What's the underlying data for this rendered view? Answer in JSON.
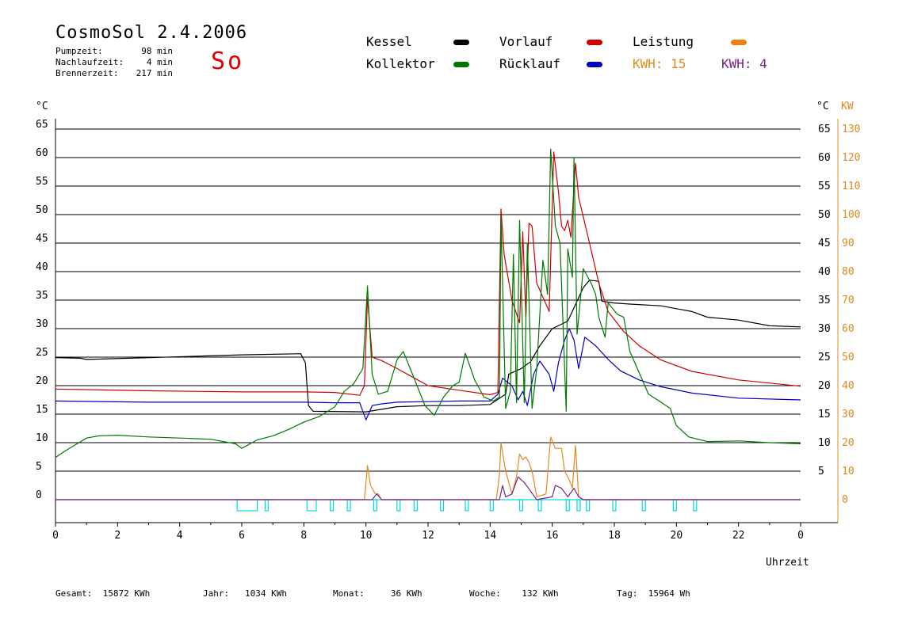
{
  "header": {
    "title": "CosmoSol 2.4.2006",
    "day": "So",
    "stats": [
      {
        "label": "Pumpzeit:",
        "value": "98 min"
      },
      {
        "label": "Nachlaufzeit:",
        "value": "4 min"
      },
      {
        "label": "Brennerzeit:",
        "value": "217 min"
      }
    ]
  },
  "legend": {
    "kessel": {
      "label": "Kessel",
      "color": "#000000"
    },
    "kollektor": {
      "label": "Kollektor",
      "color": "#007800"
    },
    "vorlauf": {
      "label": "Vorlauf",
      "color": "#d00000"
    },
    "ruecklauf": {
      "label": "Rücklauf",
      "color": "#0000c0"
    },
    "leistung": {
      "label": "Leistung",
      "color": "#f08010"
    },
    "kwh_orange": "KWH: 15",
    "kwh_purple": "KWH: 4",
    "kwh_orange_color": "#e08a1e",
    "kwh_purple_color": "#7a1f8a"
  },
  "footer": {
    "gesamt": "Gesamt:  15872 KWh",
    "jahr": "Jahr:   1034 KWh",
    "monat": "Monat:     36 KWh",
    "woche": "Woche:    132 KWh",
    "tag": "Tag:  15964 Wh"
  },
  "chart_data": {
    "type": "line",
    "title": "",
    "xlabel": "Uhrzeit",
    "ylabel_left": "°C",
    "ylabel_right_temp": "°C",
    "ylabel_right_power": "KW",
    "xlim": [
      0,
      24
    ],
    "ylim": [
      0,
      65
    ],
    "y2lim": [
      0,
      130
    ],
    "x_ticks": [
      "0",
      "2",
      "4",
      "6",
      "8",
      "10",
      "12",
      "14",
      "16",
      "18",
      "20",
      "22",
      "0"
    ],
    "y_ticks": [
      "0",
      "5",
      "10",
      "15",
      "20",
      "25",
      "30",
      "35",
      "40",
      "45",
      "50",
      "55",
      "60",
      "65"
    ],
    "y2_ticks": [
      "0",
      "10",
      "20",
      "30",
      "40",
      "50",
      "60",
      "70",
      "80",
      "90",
      "100",
      "110",
      "120",
      "130"
    ],
    "grid": true,
    "series": [
      {
        "name": "Kessel",
        "color": "#000000",
        "points": [
          [
            0,
            24.9
          ],
          [
            0.8,
            24.8
          ],
          [
            1,
            24.6
          ],
          [
            3,
            24.9
          ],
          [
            6,
            25.4
          ],
          [
            7.9,
            25.6
          ],
          [
            8.05,
            24
          ],
          [
            8.1,
            20
          ],
          [
            8.15,
            16.5
          ],
          [
            8.3,
            15.5
          ],
          [
            10,
            15.4
          ],
          [
            11,
            16.3
          ],
          [
            12,
            16.5
          ],
          [
            13,
            16.5
          ],
          [
            14,
            16.7
          ],
          [
            14.5,
            18.5
          ],
          [
            14.6,
            22
          ],
          [
            15,
            23
          ],
          [
            15.3,
            24.2
          ],
          [
            15.6,
            27
          ],
          [
            16,
            30
          ],
          [
            16.5,
            31.3
          ],
          [
            17,
            37.2
          ],
          [
            17.2,
            38.5
          ],
          [
            17.5,
            38.3
          ],
          [
            17.6,
            34.8
          ],
          [
            18,
            34.5
          ],
          [
            18.5,
            34.3
          ],
          [
            19.5,
            34
          ],
          [
            20,
            33.5
          ],
          [
            20.5,
            33
          ],
          [
            21,
            32
          ],
          [
            22,
            31.5
          ],
          [
            23,
            30.5
          ],
          [
            24,
            30.3
          ]
        ]
      },
      {
        "name": "Vorlauf",
        "color": "#d00000",
        "points": [
          [
            0,
            19.4
          ],
          [
            3,
            19.1
          ],
          [
            6,
            18.9
          ],
          [
            8,
            18.9
          ],
          [
            9,
            18.8
          ],
          [
            9.8,
            18.3
          ],
          [
            9.95,
            20
          ],
          [
            10.05,
            35.5
          ],
          [
            10.2,
            25
          ],
          [
            10.5,
            24.4
          ],
          [
            11,
            23
          ],
          [
            11.5,
            21.5
          ],
          [
            12,
            20
          ],
          [
            13,
            19.2
          ],
          [
            14,
            18.4
          ],
          [
            14.25,
            18.8
          ],
          [
            14.35,
            51
          ],
          [
            14.45,
            43
          ],
          [
            14.7,
            35
          ],
          [
            14.95,
            31
          ],
          [
            15.05,
            47
          ],
          [
            15.15,
            32
          ],
          [
            15.25,
            48.5
          ],
          [
            15.35,
            48
          ],
          [
            15.5,
            38
          ],
          [
            15.9,
            33
          ],
          [
            16.05,
            61
          ],
          [
            16.2,
            54
          ],
          [
            16.3,
            48
          ],
          [
            16.4,
            47.2
          ],
          [
            16.5,
            49
          ],
          [
            16.6,
            46
          ],
          [
            16.75,
            59
          ],
          [
            16.85,
            53
          ],
          [
            17.2,
            45
          ],
          [
            17.5,
            38
          ],
          [
            17.8,
            33
          ],
          [
            18.3,
            29.5
          ],
          [
            18.8,
            27
          ],
          [
            19.5,
            24.5
          ],
          [
            20.5,
            22.5
          ],
          [
            22,
            21
          ],
          [
            24,
            19.9
          ]
        ]
      },
      {
        "name": "Rücklauf",
        "color": "#0000c0",
        "points": [
          [
            0,
            17.3
          ],
          [
            3,
            17.1
          ],
          [
            6,
            17.1
          ],
          [
            8,
            17.1
          ],
          [
            9,
            17
          ],
          [
            9.8,
            17
          ],
          [
            10.0,
            14
          ],
          [
            10.2,
            16.5
          ],
          [
            10.5,
            16.8
          ],
          [
            11,
            17.1
          ],
          [
            12,
            17.2
          ],
          [
            13,
            17.3
          ],
          [
            14,
            17.3
          ],
          [
            14.25,
            18.5
          ],
          [
            14.4,
            21.3
          ],
          [
            14.7,
            20
          ],
          [
            14.9,
            17.5
          ],
          [
            15.05,
            19
          ],
          [
            15.2,
            16.5
          ],
          [
            15.4,
            22
          ],
          [
            15.6,
            24.3
          ],
          [
            15.9,
            22
          ],
          [
            16.05,
            19
          ],
          [
            16.2,
            24
          ],
          [
            16.4,
            28
          ],
          [
            16.55,
            30
          ],
          [
            16.7,
            28
          ],
          [
            16.85,
            23
          ],
          [
            17.05,
            28.5
          ],
          [
            17.4,
            27
          ],
          [
            17.8,
            24.6
          ],
          [
            18.2,
            22.6
          ],
          [
            18.8,
            21
          ],
          [
            19.5,
            19.8
          ],
          [
            20.5,
            18.7
          ],
          [
            22,
            17.8
          ],
          [
            24,
            17.5
          ]
        ]
      },
      {
        "name": "Kollektor",
        "color": "#007800",
        "points": [
          [
            0,
            7.4
          ],
          [
            0.3,
            8.5
          ],
          [
            0.6,
            9.5
          ],
          [
            1,
            10.8
          ],
          [
            1.4,
            11.2
          ],
          [
            2,
            11.3
          ],
          [
            3,
            11
          ],
          [
            4,
            10.8
          ],
          [
            5,
            10.6
          ],
          [
            5.8,
            9.8
          ],
          [
            6,
            9
          ],
          [
            6.5,
            10.5
          ],
          [
            7,
            11.2
          ],
          [
            7.5,
            12.3
          ],
          [
            8,
            13.6
          ],
          [
            8.5,
            14.6
          ],
          [
            9,
            16.3
          ],
          [
            9.3,
            19
          ],
          [
            9.6,
            20.3
          ],
          [
            9.9,
            23
          ],
          [
            10.05,
            37.5
          ],
          [
            10.2,
            22
          ],
          [
            10.4,
            18.5
          ],
          [
            10.7,
            19
          ],
          [
            11,
            24.5
          ],
          [
            11.2,
            26
          ],
          [
            11.5,
            22
          ],
          [
            11.9,
            16.5
          ],
          [
            12.2,
            14.8
          ],
          [
            12.5,
            18
          ],
          [
            12.8,
            20
          ],
          [
            13,
            20.6
          ],
          [
            13.2,
            25.7
          ],
          [
            13.5,
            21
          ],
          [
            13.8,
            18
          ],
          [
            14.1,
            17.3
          ],
          [
            14.3,
            18
          ],
          [
            14.35,
            49.5
          ],
          [
            14.5,
            16
          ],
          [
            14.65,
            19
          ],
          [
            14.75,
            43
          ],
          [
            14.85,
            17
          ],
          [
            14.95,
            49
          ],
          [
            15.1,
            17
          ],
          [
            15.2,
            45
          ],
          [
            15.35,
            16
          ],
          [
            15.5,
            23
          ],
          [
            15.7,
            42
          ],
          [
            15.85,
            36
          ],
          [
            15.95,
            61.5
          ],
          [
            16.1,
            48
          ],
          [
            16.25,
            45
          ],
          [
            16.45,
            15.5
          ],
          [
            16.5,
            44
          ],
          [
            16.65,
            39
          ],
          [
            16.7,
            60
          ],
          [
            16.8,
            29
          ],
          [
            17,
            40.5
          ],
          [
            17.25,
            38
          ],
          [
            17.4,
            36
          ],
          [
            17.5,
            32
          ],
          [
            17.7,
            28.5
          ],
          [
            17.8,
            34.5
          ],
          [
            18.1,
            32.5
          ],
          [
            18.3,
            32
          ],
          [
            18.5,
            26
          ],
          [
            18.9,
            21
          ],
          [
            19.1,
            18.5
          ],
          [
            19.5,
            17.1
          ],
          [
            19.8,
            16
          ],
          [
            20,
            13
          ],
          [
            20.4,
            11
          ],
          [
            21,
            10.2
          ],
          [
            22,
            10.3
          ],
          [
            23,
            10
          ],
          [
            24,
            9.8
          ]
        ]
      },
      {
        "name": "Leistung",
        "color": "#e08a1e",
        "axis": "right",
        "points": [
          [
            0,
            0
          ],
          [
            9.95,
            0
          ],
          [
            10.05,
            12
          ],
          [
            10.15,
            5
          ],
          [
            10.3,
            2
          ],
          [
            10.4,
            2
          ],
          [
            10.5,
            0
          ],
          [
            14.2,
            0
          ],
          [
            14.3,
            9
          ],
          [
            14.35,
            20
          ],
          [
            14.5,
            10
          ],
          [
            14.7,
            2
          ],
          [
            14.85,
            8
          ],
          [
            14.95,
            16
          ],
          [
            15.05,
            14
          ],
          [
            15.15,
            15
          ],
          [
            15.25,
            13
          ],
          [
            15.35,
            10
          ],
          [
            15.5,
            1
          ],
          [
            15.8,
            2
          ],
          [
            15.95,
            22
          ],
          [
            16.1,
            18
          ],
          [
            16.3,
            18
          ],
          [
            16.4,
            10
          ],
          [
            16.55,
            7
          ],
          [
            16.65,
            4
          ],
          [
            16.75,
            19
          ],
          [
            16.85,
            1
          ],
          [
            17,
            0
          ],
          [
            24,
            0
          ]
        ]
      },
      {
        "name": "Leistung2",
        "color": "#7a1f8a",
        "axis": "right",
        "points": [
          [
            0,
            0
          ],
          [
            10.2,
            0
          ],
          [
            10.35,
            2
          ],
          [
            10.5,
            0
          ],
          [
            14.3,
            0
          ],
          [
            14.4,
            5
          ],
          [
            14.5,
            1
          ],
          [
            14.7,
            2
          ],
          [
            14.9,
            8
          ],
          [
            15.1,
            6
          ],
          [
            15.3,
            3
          ],
          [
            15.5,
            0
          ],
          [
            16.0,
            1
          ],
          [
            16.1,
            5
          ],
          [
            16.3,
            4
          ],
          [
            16.5,
            1
          ],
          [
            16.7,
            4
          ],
          [
            16.85,
            1
          ],
          [
            17,
            0
          ],
          [
            24,
            0
          ]
        ]
      }
    ],
    "burner_periods": [
      [
        5.85,
        6.5
      ],
      [
        6.75,
        6.85
      ],
      [
        8.1,
        8.4
      ],
      [
        8.85,
        8.95
      ],
      [
        9.4,
        9.5
      ],
      [
        10.25,
        10.35
      ],
      [
        11.0,
        11.1
      ],
      [
        11.55,
        11.65
      ],
      [
        12.4,
        12.5
      ],
      [
        13.2,
        13.3
      ],
      [
        14.0,
        14.1
      ],
      [
        14.95,
        15.05
      ],
      [
        15.55,
        15.65
      ],
      [
        16.45,
        16.55
      ],
      [
        16.8,
        16.9
      ],
      [
        17.1,
        17.2
      ],
      [
        17.95,
        18.05
      ],
      [
        18.9,
        19.0
      ],
      [
        19.9,
        20.0
      ],
      [
        20.55,
        20.65
      ]
    ]
  }
}
